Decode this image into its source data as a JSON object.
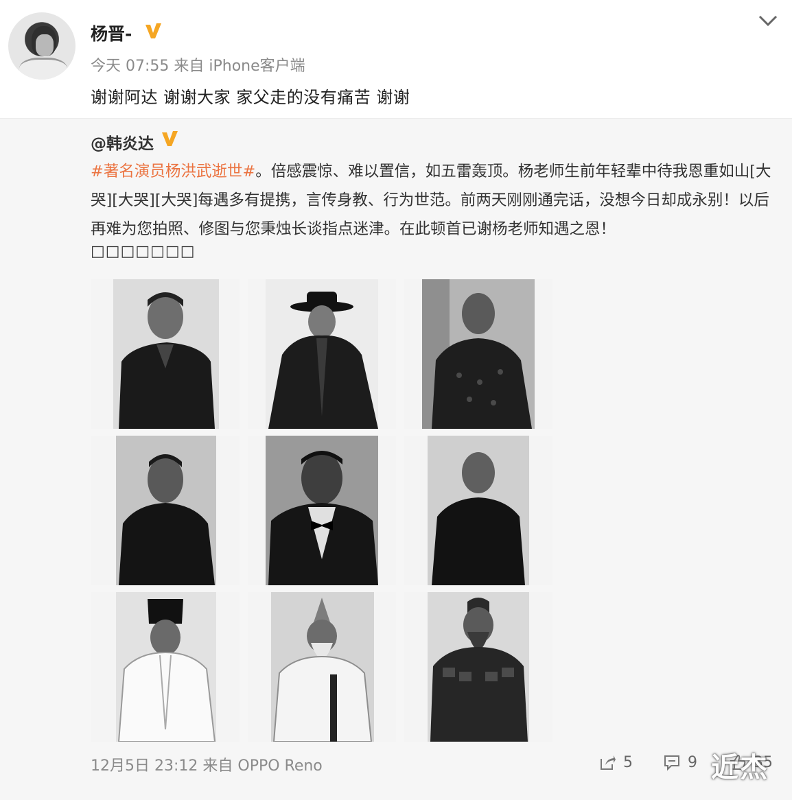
{
  "post": {
    "author": "杨晋-",
    "meta": "今天 07:55 来自 iPhone客户端",
    "content": "谢谢阿达 谢谢大家 家父走的没有痛苦 谢谢"
  },
  "repost": {
    "author": "@韩炎达",
    "hashtag": "#著名演员杨洪武逝世#",
    "text": "。倍感震惊、难以置信，如五雷轰顶。杨老师生前年轻辈中待我恩重如山[大哭][大哭][大哭]每遇多有提携，言传身教、行为世范。前两天刚刚通完话，没想今日却成永别！以后再难为您拍照、修图与您秉烛长谈指点迷津。在此顿首已谢杨老师知遇之恩！",
    "garbled": "□□□□□□□",
    "photos": [
      {
        "id": "photo-1",
        "subject": "man-dark-coat"
      },
      {
        "id": "photo-2",
        "subject": "man-hat-cloak"
      },
      {
        "id": "photo-3",
        "subject": "man-brocade-jacket"
      },
      {
        "id": "photo-4",
        "subject": "man-dark-robe"
      },
      {
        "id": "photo-5",
        "subject": "man-tuxedo-bowtie"
      },
      {
        "id": "photo-6",
        "subject": "man-black-robe"
      },
      {
        "id": "photo-7",
        "subject": "man-official-hat-white-robe"
      },
      {
        "id": "photo-8",
        "subject": "elder-helmet-white-robe"
      },
      {
        "id": "photo-9",
        "subject": "general-armor"
      }
    ],
    "footer_meta": "12月5日 23:12 来自 OPPO Reno",
    "share_count": "5",
    "comment_count": "9",
    "like_count": "35"
  },
  "watermark": "近杰",
  "colors": {
    "hashtag": "#eb7340",
    "verified_badge": "#f5a623",
    "meta_text": "#8a8a8a"
  }
}
